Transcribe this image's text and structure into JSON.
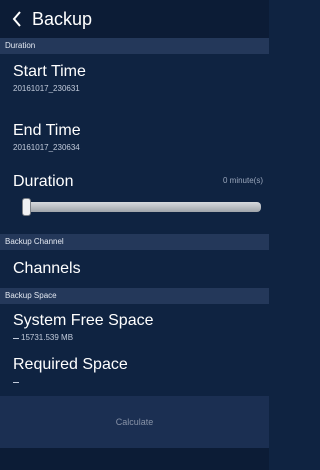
{
  "header": {
    "title": "Backup",
    "back_icon": "chevron-left-icon"
  },
  "sections": {
    "duration": "Duration",
    "backup_channel": "Backup Channel",
    "backup_space": "Backup Space"
  },
  "start_time": {
    "label": "Start Time",
    "value": "20161017_230631"
  },
  "end_time": {
    "label": "End Time",
    "value": "20161017_230634"
  },
  "duration": {
    "label": "Duration",
    "value": "0 minute(s)",
    "slider_fraction": 0.0
  },
  "channels": {
    "label": "Channels"
  },
  "free_space": {
    "label": "System Free Space",
    "value": "15731.539 MB"
  },
  "required_space": {
    "label": "Required Space"
  },
  "calculate_label": "Calculate",
  "colors": {
    "background": "#0f2341",
    "header": "#0c1c36",
    "section": "#24385a",
    "calc": "#1b2f52"
  }
}
